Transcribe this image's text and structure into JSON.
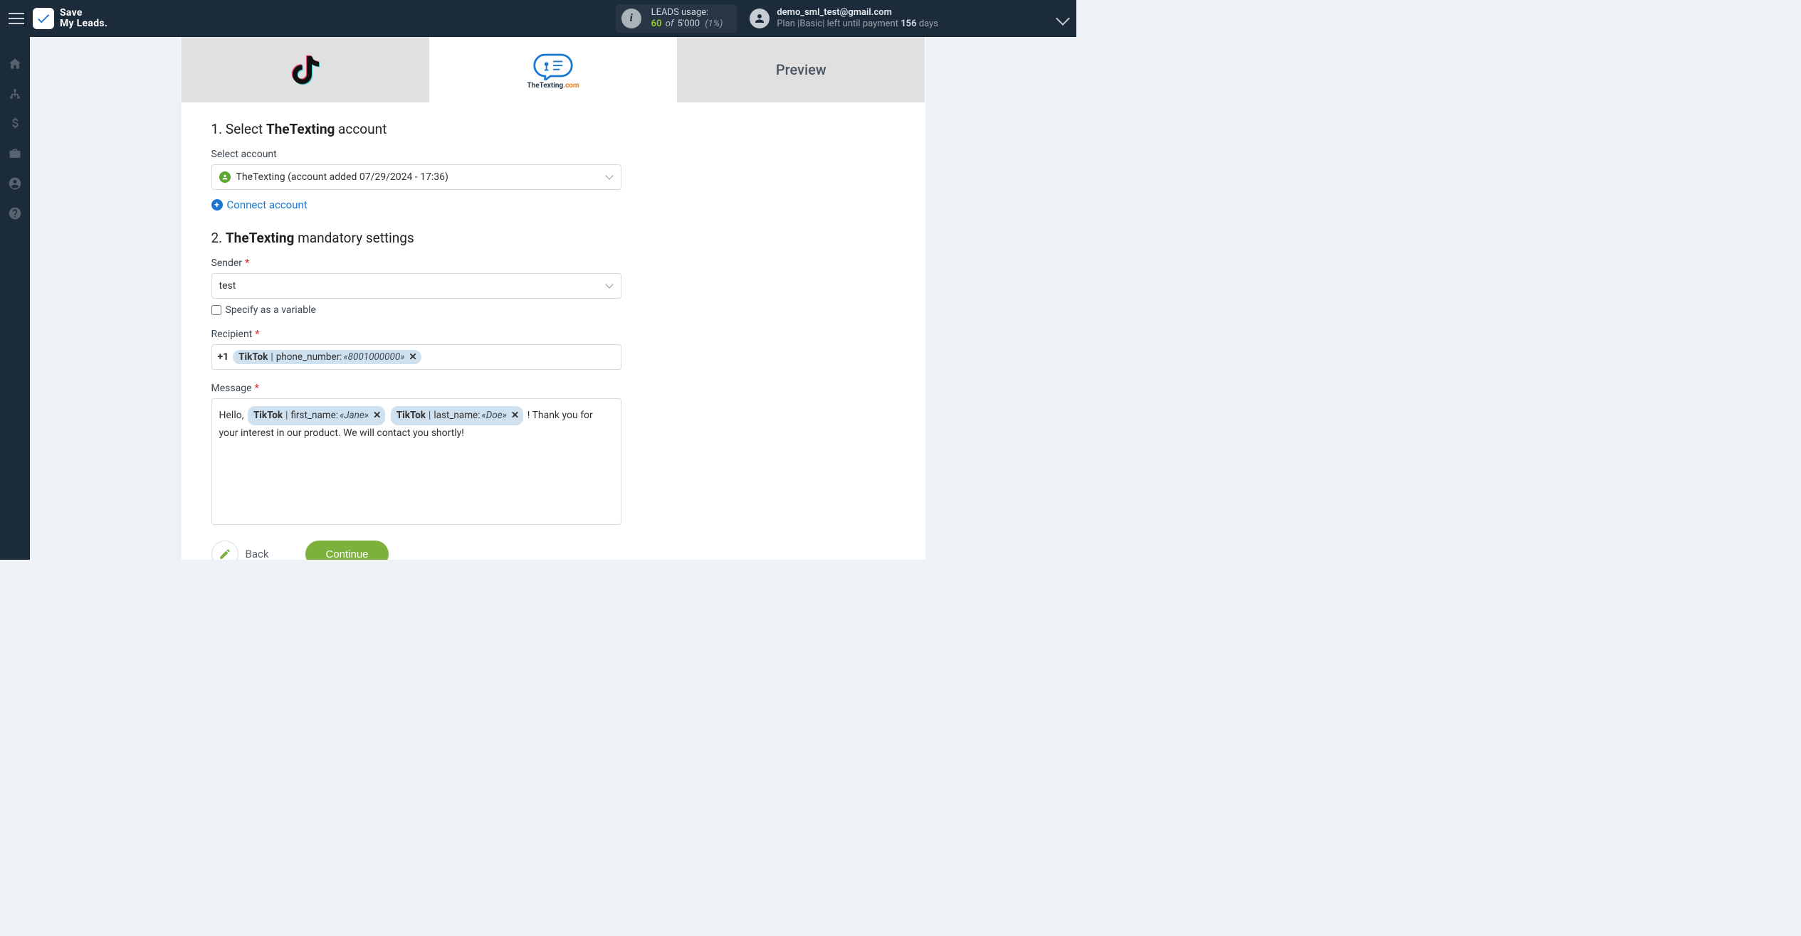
{
  "brand": {
    "line1": "Save",
    "line2": "My Leads."
  },
  "usage": {
    "label": "LEADS usage:",
    "current": "60",
    "of_word": "of",
    "limit": "5'000",
    "percent": "(1%)"
  },
  "user": {
    "email": "demo_sml_test@gmail.com",
    "plan_prefix": "Plan |",
    "plan_name": "Basic",
    "plan_mid": "| left until payment ",
    "days_value": "156",
    "days_word": " days"
  },
  "tabs": {
    "source_name": "TikTok",
    "dest_name": "TheTexting",
    "dest_tld": ".com",
    "preview": "Preview"
  },
  "section1": {
    "num": "1. ",
    "prefix": "Select ",
    "bold": "TheTexting",
    "suffix": " account",
    "select_label": "Select account",
    "selected_account": "TheTexting (account added 07/29/2024 - 17:36)",
    "connect": "Connect account"
  },
  "section2": {
    "num": "2. ",
    "bold": "TheTexting",
    "suffix": " mandatory settings",
    "sender_label": "Sender",
    "sender_value": "test",
    "specify_var": "Specify as a variable",
    "recipient_label": "Recipient",
    "recipient_prefix": "+1",
    "recipient_chip": {
      "source": "TikTok",
      "field": "phone_number:",
      "example": "«8001000000»"
    },
    "message_label": "Message",
    "message": {
      "text_before": "Hello, ",
      "chip1": {
        "source": "TikTok",
        "field": "first_name:",
        "example": "«Jane»"
      },
      "chip2": {
        "source": "TikTok",
        "field": "last_name:",
        "example": "«Doe»"
      },
      "text_after": " ! Thank you for your interest in our product. We will contact you shortly!"
    }
  },
  "actions": {
    "back": "Back",
    "continue": "Continue"
  }
}
